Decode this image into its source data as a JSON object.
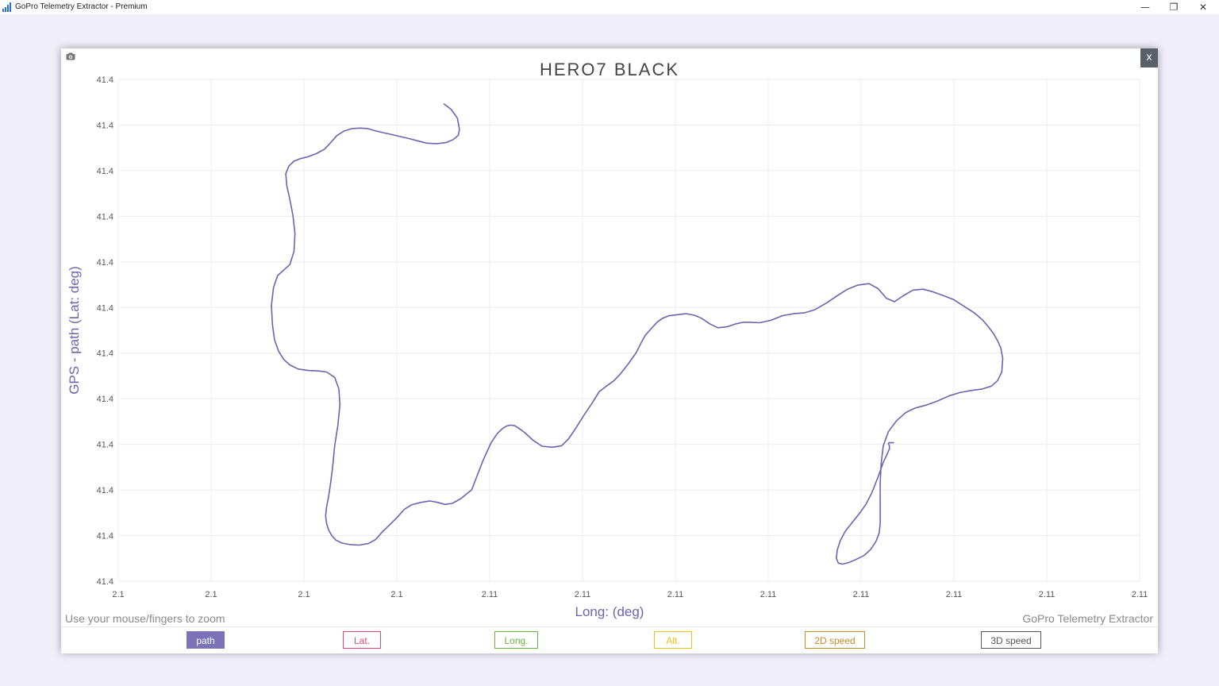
{
  "window": {
    "title": "GoPro Telemetry Extractor - Premium",
    "minimize_glyph": "—",
    "restore_glyph": "❐",
    "close_glyph": "✕"
  },
  "panel": {
    "close_label": "x",
    "footer_hint": "Use your mouse/fingers to zoom",
    "footer_brand": "GoPro Telemetry Extractor"
  },
  "tabs": [
    {
      "label": "path",
      "color": "#7b72b8",
      "active": true
    },
    {
      "label": "Lat.",
      "color": "#e0457b",
      "active": false
    },
    {
      "label": "Long.",
      "color": "#6ab33e",
      "active": false
    },
    {
      "label": "Alt.",
      "color": "#f0c020",
      "active": false
    },
    {
      "label": "2D speed",
      "color": "#c58a2a",
      "active": false
    },
    {
      "label": "3D speed",
      "color": "#555555",
      "active": false
    }
  ],
  "chart_data": {
    "type": "line",
    "title": "HERO7 BLACK",
    "xlabel": "Long: (deg)",
    "ylabel": "GPS - path (Lat: deg)",
    "x_tick_labels": [
      "2.1",
      "2.1",
      "2.1",
      "2.1",
      "2.11",
      "2.11",
      "2.11",
      "2.11",
      "2.11",
      "2.11",
      "2.11",
      "2.11"
    ],
    "y_tick_labels": [
      "41.4",
      "41.4",
      "41.4",
      "41.4",
      "41.4",
      "41.4",
      "41.4",
      "41.4",
      "41.4",
      "41.4",
      "41.4",
      "41.4"
    ],
    "grid": true,
    "line_color": "#6c63b0",
    "series": [
      {
        "x_frac": [
          0.319,
          0.326,
          0.332,
          0.334,
          0.333,
          0.328,
          0.321,
          0.312,
          0.302,
          0.294,
          0.285,
          0.276,
          0.268,
          0.259,
          0.251,
          0.244,
          0.237,
          0.229,
          0.221,
          0.214,
          0.208,
          0.202,
          0.194,
          0.186,
          0.178,
          0.172,
          0.167,
          0.164,
          0.165,
          0.168,
          0.171,
          0.173,
          0.172,
          0.168,
          0.162,
          0.156,
          0.152,
          0.15,
          0.151,
          0.153,
          0.157,
          0.162,
          0.168,
          0.176,
          0.186,
          0.196,
          0.204,
          0.212,
          0.216,
          0.217,
          0.215,
          0.212,
          0.21,
          0.208,
          0.206,
          0.204,
          0.203,
          0.204,
          0.206,
          0.209,
          0.213,
          0.219,
          0.227,
          0.236,
          0.245,
          0.252,
          0.258,
          0.265,
          0.273,
          0.28,
          0.287,
          0.296,
          0.305,
          0.313,
          0.32,
          0.327,
          0.335,
          0.346,
          0.357,
          0.365,
          0.371,
          0.376,
          0.38,
          0.384,
          0.388,
          0.392,
          0.398,
          0.406,
          0.415,
          0.425,
          0.434,
          0.441,
          0.448,
          0.456,
          0.464,
          0.471,
          0.478,
          0.485,
          0.492,
          0.5,
          0.507,
          0.512,
          0.516,
          0.522,
          0.528,
          0.533,
          0.539,
          0.547,
          0.556,
          0.564,
          0.571,
          0.579,
          0.587,
          0.596,
          0.605,
          0.612,
          0.619,
          0.628,
          0.639,
          0.65,
          0.661,
          0.672,
          0.682,
          0.693,
          0.704,
          0.714,
          0.724,
          0.735,
          0.744,
          0.752,
          0.76,
          0.768,
          0.778,
          0.788,
          0.797,
          0.808,
          0.818,
          0.828,
          0.838,
          0.846,
          0.852,
          0.857,
          0.861,
          0.864,
          0.866,
          0.865,
          0.861,
          0.855,
          0.846,
          0.835,
          0.824,
          0.813,
          0.802,
          0.791,
          0.78,
          0.771,
          0.762,
          0.754,
          0.749,
          0.747,
          0.746,
          0.746,
          0.746,
          0.746,
          0.745,
          0.742,
          0.737,
          0.73,
          0.722,
          0.715,
          0.709,
          0.705,
          0.703,
          0.704,
          0.707,
          0.712,
          0.719,
          0.726,
          0.732,
          0.738,
          0.744,
          0.749,
          0.753,
          0.755,
          0.755,
          0.754,
          0.754,
          0.755,
          0.759,
          0.765,
          0.773,
          0.782,
          0.79,
          0.797
        ],
        "y_frac": [
          0.049,
          0.06,
          0.077,
          0.099,
          0.111,
          0.12,
          0.126,
          0.128,
          0.127,
          0.123,
          0.118,
          0.114,
          0.11,
          0.106,
          0.102,
          0.098,
          0.097,
          0.098,
          0.103,
          0.112,
          0.126,
          0.139,
          0.148,
          0.154,
          0.158,
          0.163,
          0.173,
          0.188,
          0.212,
          0.239,
          0.271,
          0.307,
          0.343,
          0.369,
          0.38,
          0.391,
          0.415,
          0.451,
          0.489,
          0.519,
          0.542,
          0.558,
          0.569,
          0.577,
          0.58,
          0.581,
          0.583,
          0.594,
          0.617,
          0.648,
          0.69,
          0.729,
          0.77,
          0.803,
          0.831,
          0.852,
          0.87,
          0.885,
          0.898,
          0.909,
          0.918,
          0.924,
          0.927,
          0.928,
          0.925,
          0.917,
          0.903,
          0.889,
          0.873,
          0.857,
          0.848,
          0.843,
          0.84,
          0.843,
          0.847,
          0.845,
          0.836,
          0.818,
          0.76,
          0.724,
          0.706,
          0.696,
          0.691,
          0.689,
          0.69,
          0.695,
          0.704,
          0.719,
          0.731,
          0.733,
          0.73,
          0.716,
          0.695,
          0.669,
          0.645,
          0.622,
          0.611,
          0.601,
          0.586,
          0.565,
          0.545,
          0.525,
          0.51,
          0.496,
          0.483,
          0.476,
          0.471,
          0.469,
          0.467,
          0.47,
          0.476,
          0.487,
          0.495,
          0.493,
          0.487,
          0.484,
          0.484,
          0.485,
          0.48,
          0.471,
          0.467,
          0.465,
          0.459,
          0.446,
          0.431,
          0.418,
          0.41,
          0.407,
          0.417,
          0.436,
          0.443,
          0.432,
          0.42,
          0.418,
          0.423,
          0.431,
          0.439,
          0.452,
          0.465,
          0.479,
          0.493,
          0.507,
          0.521,
          0.535,
          0.556,
          0.583,
          0.6,
          0.611,
          0.617,
          0.62,
          0.624,
          0.631,
          0.641,
          0.649,
          0.655,
          0.664,
          0.68,
          0.702,
          0.73,
          0.764,
          0.803,
          0.84,
          0.864,
          0.885,
          0.904,
          0.92,
          0.936,
          0.949,
          0.957,
          0.963,
          0.966,
          0.964,
          0.954,
          0.938,
          0.919,
          0.9,
          0.882,
          0.864,
          0.847,
          0.823,
          0.792,
          0.763,
          0.746,
          0.736,
          0.73,
          0.726,
          0.725,
          0.724,
          0.724
        ]
      }
    ]
  }
}
